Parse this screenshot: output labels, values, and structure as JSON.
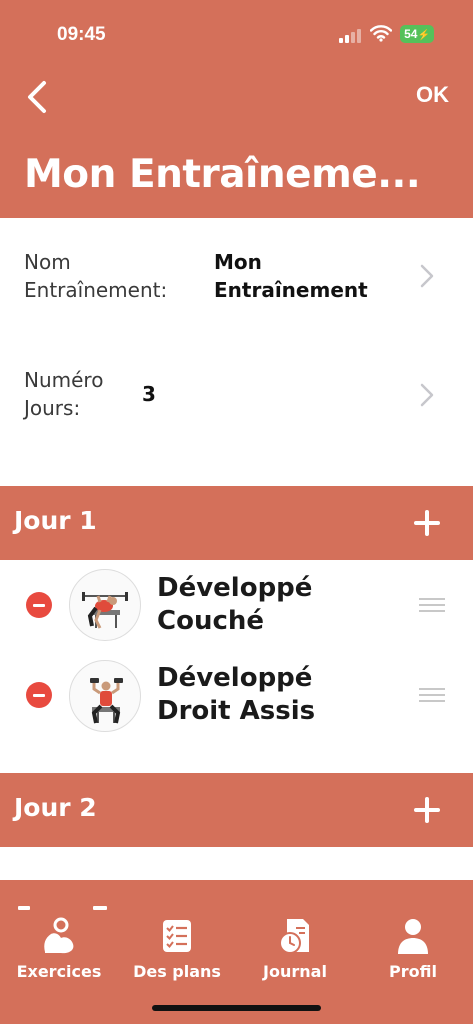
{
  "status_bar": {
    "time": "09:45",
    "battery": "54"
  },
  "header": {
    "ok_label": "OK",
    "title": "Mon Entraîneme..."
  },
  "info": [
    {
      "label": "Nom\nEntraînement:",
      "value": "Mon\nEntraînement"
    },
    {
      "label": "Numéro\nJours:",
      "value": "3"
    }
  ],
  "days": [
    {
      "label": "Jour 1",
      "exercises": [
        {
          "name": "Développé\nCouché"
        },
        {
          "name": "Développé\nDroit Assis"
        }
      ]
    },
    {
      "label": "Jour 2",
      "exercises": []
    }
  ],
  "tabbar": {
    "items": [
      {
        "label": "Exercices",
        "icon": "muscle-icon"
      },
      {
        "label": "Des plans",
        "icon": "checklist-icon"
      },
      {
        "label": "Journal",
        "icon": "journal-clock-icon"
      },
      {
        "label": "Profil",
        "icon": "person-icon"
      }
    ]
  },
  "colors": {
    "accent": "#D4705A",
    "remove": "#E84A3F",
    "battery": "#55C15A"
  }
}
